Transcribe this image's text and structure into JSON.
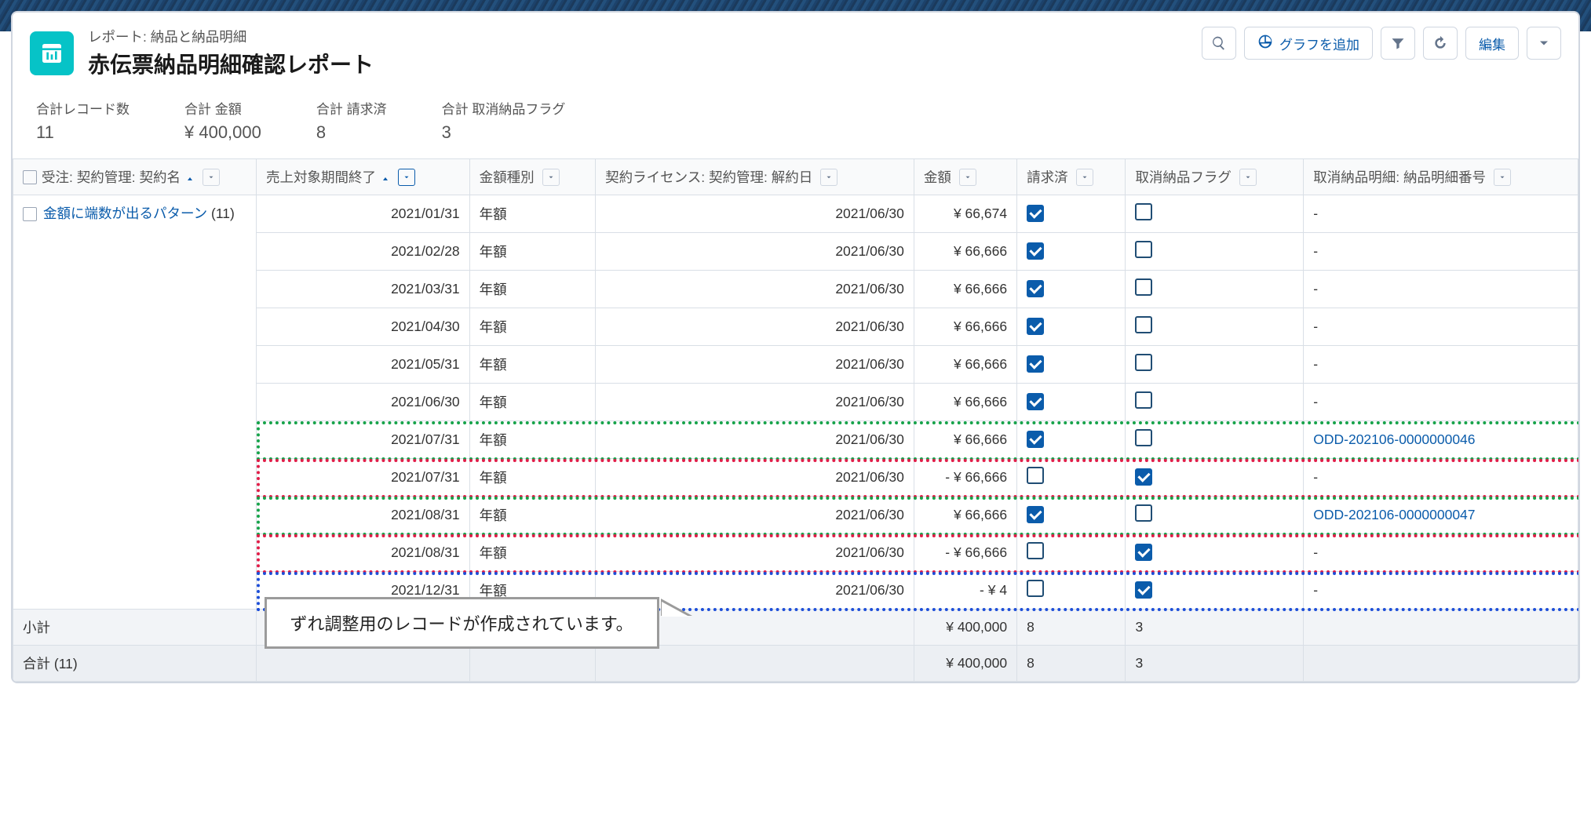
{
  "header": {
    "breadcrumb": "レポート: 納品と納品明細",
    "title": "赤伝票納品明細確認レポート",
    "add_chart_label": "グラフを追加",
    "edit_label": "編集"
  },
  "summary": {
    "record_count_label": "合計レコード数",
    "record_count_value": "11",
    "total_amount_label": "合計 金額",
    "total_amount_value": "¥ 400,000",
    "total_billed_label": "合計 請求済",
    "total_billed_value": "8",
    "total_cancel_flag_label": "合計 取消納品フラグ",
    "total_cancel_flag_value": "3"
  },
  "columns": {
    "c0": "受注: 契約管理: 契約名",
    "c1": "売上対象期間終了",
    "c2": "金額種別",
    "c3": "契約ライセンス: 契約管理: 解約日",
    "c4": "金額",
    "c5": "請求済",
    "c6": "取消納品フラグ",
    "c7": "取消納品明細: 納品明細番号"
  },
  "group": {
    "link_text": "金額に端数が出るパターン",
    "count": "(11)"
  },
  "rows": [
    {
      "c1": "2021/01/31",
      "c2": "年額",
      "c3": "2021/06/30",
      "c4": "¥ 66,674",
      "c5": true,
      "c6": false,
      "c7": "-"
    },
    {
      "c1": "2021/02/28",
      "c2": "年額",
      "c3": "2021/06/30",
      "c4": "¥ 66,666",
      "c5": true,
      "c6": false,
      "c7": "-"
    },
    {
      "c1": "2021/03/31",
      "c2": "年額",
      "c3": "2021/06/30",
      "c4": "¥ 66,666",
      "c5": true,
      "c6": false,
      "c7": "-"
    },
    {
      "c1": "2021/04/30",
      "c2": "年額",
      "c3": "2021/06/30",
      "c4": "¥ 66,666",
      "c5": true,
      "c6": false,
      "c7": "-"
    },
    {
      "c1": "2021/05/31",
      "c2": "年額",
      "c3": "2021/06/30",
      "c4": "¥ 66,666",
      "c5": true,
      "c6": false,
      "c7": "-"
    },
    {
      "c1": "2021/06/30",
      "c2": "年額",
      "c3": "2021/06/30",
      "c4": "¥ 66,666",
      "c5": true,
      "c6": false,
      "c7": "-"
    },
    {
      "c1": "2021/07/31",
      "c2": "年額",
      "c3": "2021/06/30",
      "c4": "¥ 66,666",
      "c5": true,
      "c6": false,
      "c7": "ODD-202106-0000000046",
      "c7_link": true
    },
    {
      "c1": "2021/07/31",
      "c2": "年額",
      "c3": "2021/06/30",
      "c4": "- ¥ 66,666",
      "c5": false,
      "c6": true,
      "c7": "-"
    },
    {
      "c1": "2021/08/31",
      "c2": "年額",
      "c3": "2021/06/30",
      "c4": "¥ 66,666",
      "c5": true,
      "c6": false,
      "c7": "ODD-202106-0000000047",
      "c7_link": true
    },
    {
      "c1": "2021/08/31",
      "c2": "年額",
      "c3": "2021/06/30",
      "c4": "- ¥ 66,666",
      "c5": false,
      "c6": true,
      "c7": "-"
    },
    {
      "c1": "2021/12/31",
      "c2": "年額",
      "c3": "2021/06/30",
      "c4": "- ¥ 4",
      "c5": false,
      "c6": true,
      "c7": "-"
    }
  ],
  "subtotal": {
    "label": "小計",
    "c4": "¥ 400,000",
    "c5": "8",
    "c6": "3"
  },
  "total": {
    "label": "合計 (11)",
    "c4": "¥ 400,000",
    "c5": "8",
    "c6": "3"
  },
  "callout": "ずれ調整用のレコードが作成されています。"
}
